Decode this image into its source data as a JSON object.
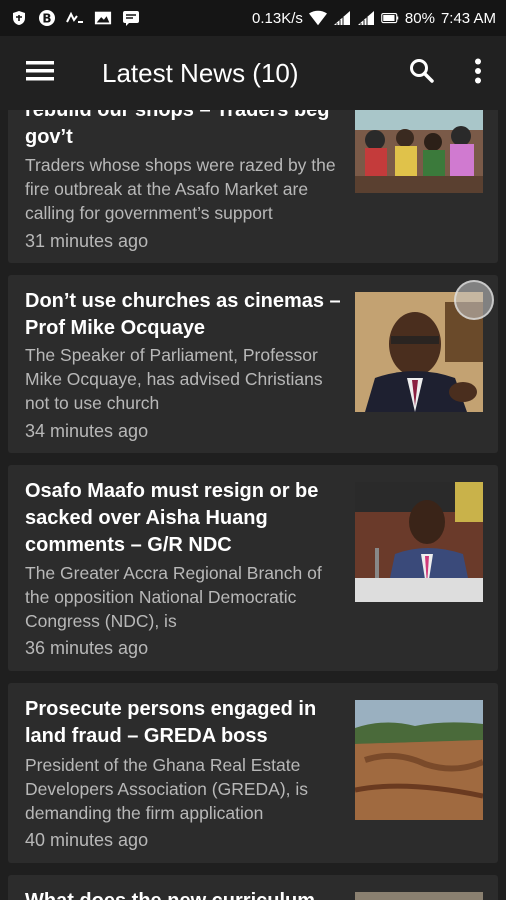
{
  "status_bar": {
    "net_speed": "0.13K/s",
    "battery": "80%",
    "time": "7:43 AM"
  },
  "app_bar": {
    "title": "Latest News (10)"
  },
  "articles": [
    {
      "title_line1": "rebuild our shops – Traders beg",
      "title_line2": "gov’t",
      "summary": "Traders whose shops were razed by the fire outbreak at the Asafo Market are calling for government’s support",
      "time": "31 minutes ago",
      "image": "market-fire-traders-photo"
    },
    {
      "title": "Don’t use churches as cinemas – Prof Mike Ocquaye",
      "summary": "The Speaker of Parliament, Professor Mike Ocquaye, has advised Christians not to use church",
      "time": "34 minutes ago",
      "image": "speaker-portrait-photo"
    },
    {
      "title": "Osafo Maafo must resign or be sacked over Aisha Huang comments – G/R NDC",
      "summary": "The Greater Accra Regional Branch of the opposition National Democratic Congress (NDC), is",
      "time": "36 minutes ago",
      "image": "minister-at-hearing-photo"
    },
    {
      "title": "Prosecute persons engaged in land fraud – GREDA boss",
      "summary": "President of the Ghana Real Estate Developers Association (GREDA), is demanding the firm application",
      "time": "40 minutes ago",
      "image": "eroded-land-photo"
    },
    {
      "title": "What does the new curriculum",
      "image": "curriculum-photo"
    }
  ]
}
